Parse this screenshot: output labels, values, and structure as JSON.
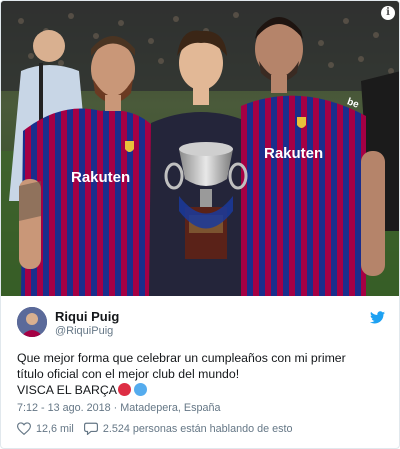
{
  "tweet": {
    "author_name": "Riqui Puig",
    "author_handle": "@RiquiPuig",
    "text_lines": [
      "Que mejor forma que celebrar un cumpleaños con mi primer",
      "título oficial con el mejor club del mundo!",
      "VISCA EL BARÇA"
    ],
    "emojis": [
      "red-circle",
      "blue-circle"
    ],
    "timestamp_location": "7:12 - 13 ago. 2018 · Matadepera, España",
    "likes": "12,6 mil",
    "conversation": "2.524 personas están hablando de esto"
  },
  "photo": {
    "shirt_sponsor": "Rakuten",
    "sleeve_text": "be"
  },
  "colors": {
    "twitter_blue": "#1da1f2",
    "text_secondary": "#657786",
    "barca_blue": "#1a2e8c",
    "barca_red": "#a50044",
    "emoji_red": "#dd2e44",
    "emoji_blue": "#55acee"
  },
  "icons": {
    "info": "info-icon",
    "twitter": "twitter-bird-icon",
    "like": "heart-icon",
    "reply": "speech-bubble-icon"
  }
}
